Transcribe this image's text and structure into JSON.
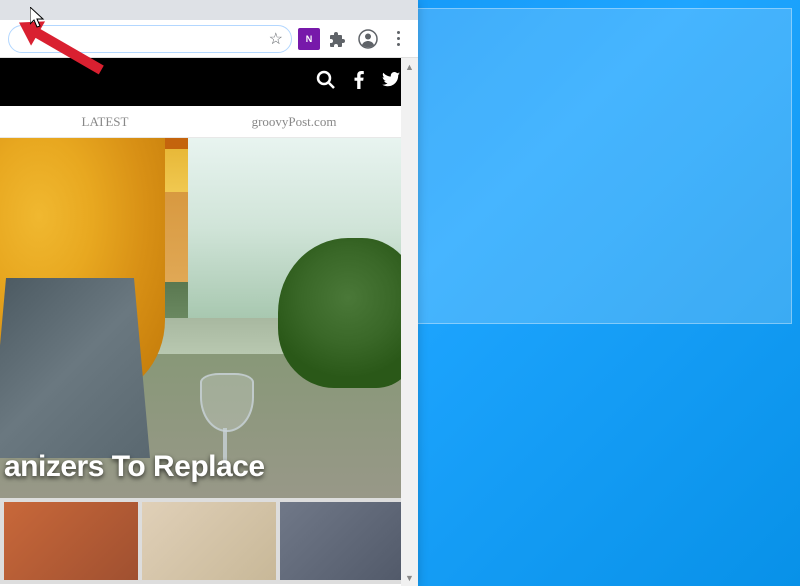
{
  "browser": {
    "extension_label": "N",
    "address_bar": ""
  },
  "site": {
    "nav": {
      "latest": "LATEST",
      "brand": "groovyPost.com"
    },
    "headline": "anizers To Replace"
  },
  "icons": {
    "star": "star-icon",
    "puzzle": "extensions-icon",
    "profile": "profile-icon",
    "menu": "menu-icon",
    "search": "search-icon",
    "facebook": "facebook-icon",
    "twitter": "twitter-icon"
  }
}
